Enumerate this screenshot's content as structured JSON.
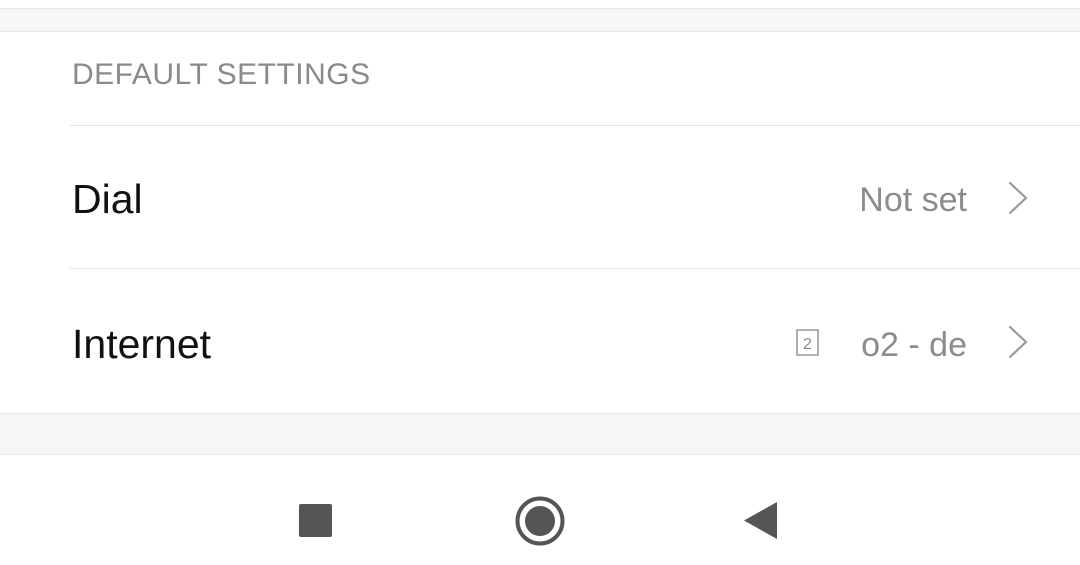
{
  "section": {
    "header": "DEFAULT SETTINGS"
  },
  "rows": [
    {
      "label": "Dial",
      "value": "Not set",
      "icon": "chevron-right-icon"
    },
    {
      "label": "Internet",
      "value": "o2 - de",
      "sim_badge": "2",
      "icon": "chevron-right-icon"
    }
  ],
  "navbar": {
    "recents_icon": "square-icon",
    "home_icon": "circle-icon",
    "back_icon": "triangle-back-icon"
  },
  "colors": {
    "background": "#ffffff",
    "gap": "#f6f6f6",
    "divider": "#e3e3e3",
    "label": "#111111",
    "secondary": "#8c8c8c",
    "nav_icon": "#555555"
  }
}
